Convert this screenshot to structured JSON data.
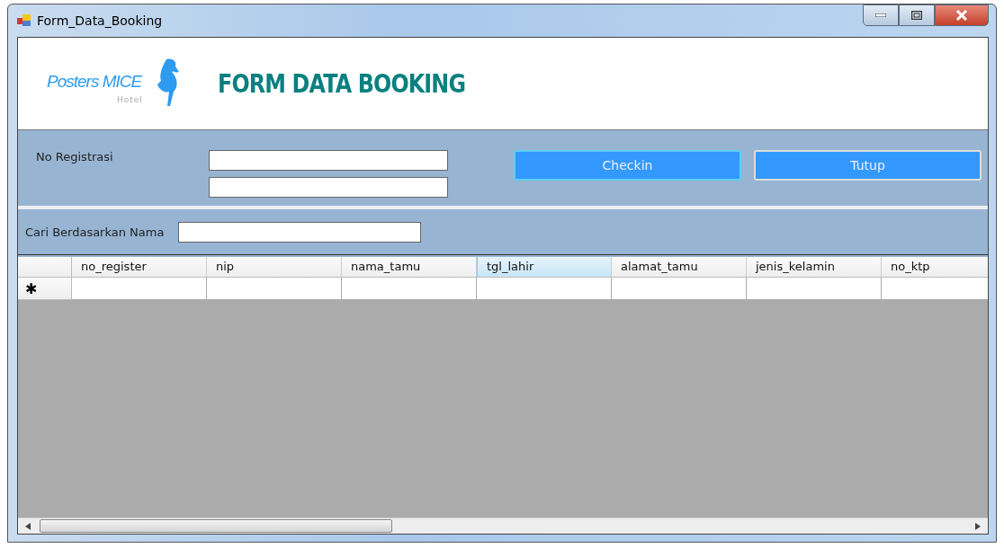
{
  "window": {
    "title": "Form_Data_Booking"
  },
  "logo": {
    "name": "Posters MICE",
    "subtitle": "Hotel"
  },
  "heading": "FORM DATA BOOKING",
  "registration": {
    "label": "No Registrasi",
    "fields": [
      {
        "kind": "textbox"
      },
      {
        "kind": "textbox"
      }
    ]
  },
  "buttons": [
    {
      "label": "Checkin",
      "focused": true
    },
    {
      "label": "Tutup",
      "focused": false
    }
  ],
  "search": {
    "label": "Cari Berdasarkan Nama"
  },
  "grid": {
    "new_row_marker": "✱",
    "columns": [
      {
        "label": "no_register",
        "selected": false
      },
      {
        "label": "nip",
        "selected": false
      },
      {
        "label": "nama_tamu",
        "selected": false
      },
      {
        "label": "tgl_lahir",
        "selected": true
      },
      {
        "label": "alamat_tamu",
        "selected": false
      },
      {
        "label": "jenis_kelamin",
        "selected": false
      },
      {
        "label": "no_ktp",
        "selected": false
      }
    ]
  }
}
